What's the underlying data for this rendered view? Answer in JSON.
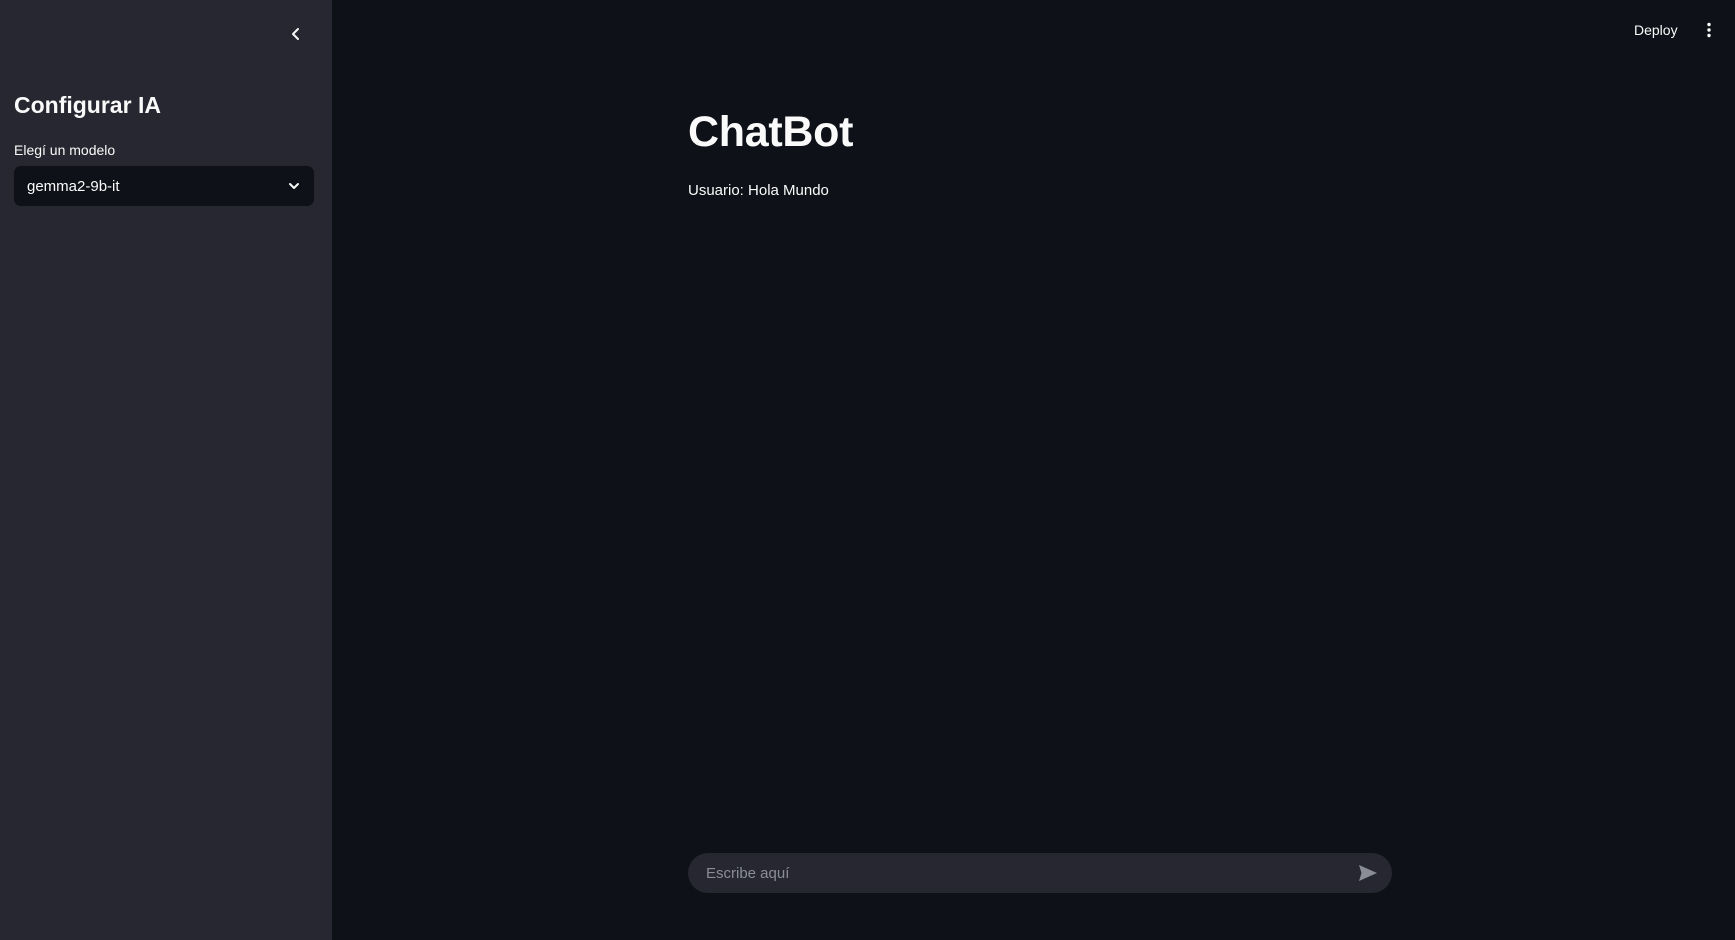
{
  "sidebar": {
    "collapse_icon": "chevron-left-icon",
    "title": "Configurar IA",
    "model_select": {
      "label": "Elegí un modelo",
      "value": "gemma2-9b-it",
      "chevron_icon": "chevron-down-icon"
    }
  },
  "header": {
    "deploy_label": "Deploy",
    "menu_icon": "vertical-dots-icon"
  },
  "main": {
    "title": "ChatBot",
    "messages": [
      {
        "text": "Usuario: Hola Mundo"
      }
    ]
  },
  "chat_input": {
    "placeholder": "Escribe aquí",
    "send_icon": "send-icon"
  },
  "colors": {
    "background": "#0e1117",
    "sidebar_bg": "#262730",
    "text": "#fafafa",
    "placeholder": "#8b8d96"
  }
}
